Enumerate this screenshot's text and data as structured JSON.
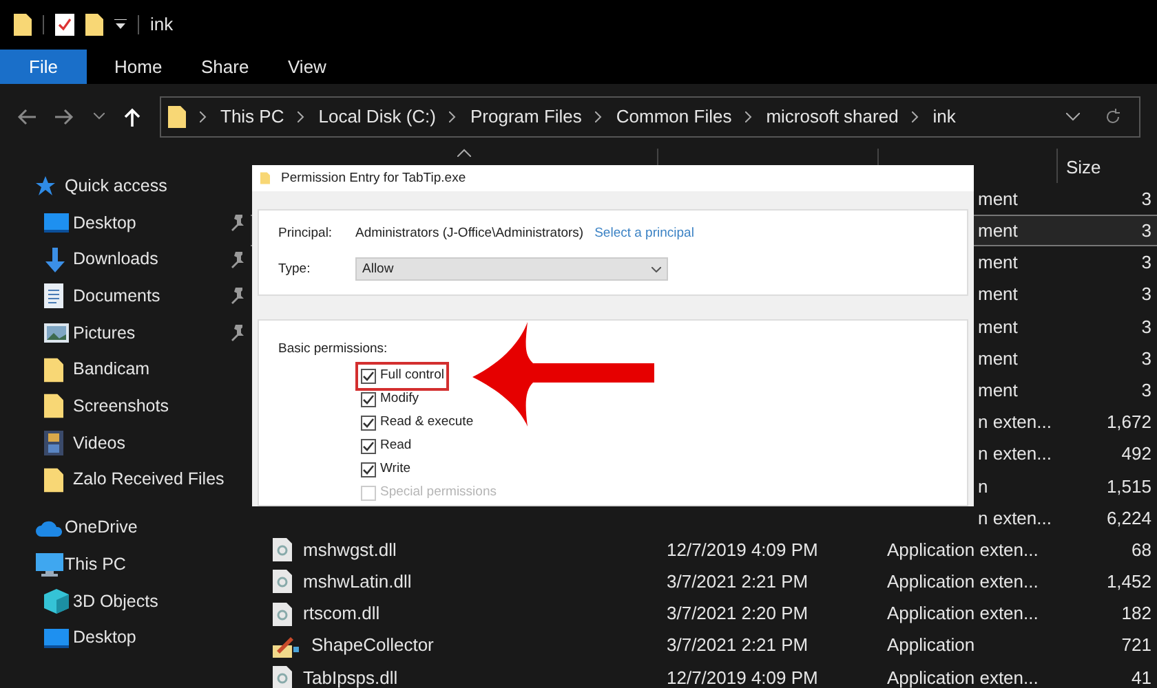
{
  "window": {
    "title": "ink"
  },
  "ribbon_tabs": [
    {
      "label": "File",
      "selected": true
    },
    {
      "label": "Home",
      "selected": false
    },
    {
      "label": "Share",
      "selected": false
    },
    {
      "label": "View",
      "selected": false
    }
  ],
  "breadcrumb": [
    "This PC",
    "Local Disk (C:)",
    "Program Files",
    "Common Files",
    "microsoft shared",
    "ink"
  ],
  "sidebar": {
    "items": [
      {
        "label": "Quick access",
        "kind": "star",
        "pinned": false,
        "children": [
          {
            "label": "Desktop",
            "kind": "desktop",
            "pinned": true
          },
          {
            "label": "Downloads",
            "kind": "download",
            "pinned": true
          },
          {
            "label": "Documents",
            "kind": "document",
            "pinned": true
          },
          {
            "label": "Pictures",
            "kind": "pictures",
            "pinned": true
          },
          {
            "label": "Bandicam",
            "kind": "folder",
            "pinned": false
          },
          {
            "label": "Screenshots",
            "kind": "folder",
            "pinned": false
          },
          {
            "label": "Videos",
            "kind": "videos",
            "pinned": false
          },
          {
            "label": "Zalo Received Files",
            "kind": "folder",
            "pinned": false
          }
        ]
      },
      {
        "label": "OneDrive",
        "kind": "cloud",
        "pinned": false
      },
      {
        "label": "This PC",
        "kind": "pc",
        "pinned": false,
        "children": [
          {
            "label": "3D Objects",
            "kind": "cube",
            "pinned": false
          },
          {
            "label": "Desktop",
            "kind": "desktop",
            "pinned": false
          }
        ]
      }
    ]
  },
  "file_list": {
    "size_header": "Size",
    "rows": [
      {
        "kind": "partial",
        "type": "ment",
        "size": "3",
        "selected": false
      },
      {
        "kind": "partial",
        "type": "ment",
        "size": "3",
        "selected": true
      },
      {
        "kind": "partial",
        "type": "ment",
        "size": "3",
        "selected": false
      },
      {
        "kind": "partial",
        "type": "ment",
        "size": "3",
        "selected": false
      },
      {
        "kind": "partial",
        "type": "ment",
        "size": "3",
        "selected": false
      },
      {
        "kind": "partial",
        "type": "ment",
        "size": "3",
        "selected": false
      },
      {
        "kind": "partial",
        "type": "ment",
        "size": "3",
        "selected": false
      },
      {
        "kind": "partial",
        "type": "n exten...",
        "size": "1,672",
        "selected": false
      },
      {
        "kind": "partial",
        "type": "n exten...",
        "size": "492",
        "selected": false
      },
      {
        "kind": "partial",
        "type": "n",
        "size": "1,515",
        "selected": false
      },
      {
        "kind": "partial",
        "type": "n exten...",
        "size": "6,224",
        "selected": false
      },
      {
        "kind": "dll",
        "name": "mshwgst.dll",
        "date": "12/7/2019 4:09 PM",
        "type": "Application exten...",
        "size": "68",
        "selected": false
      },
      {
        "kind": "dll",
        "name": "mshwLatin.dll",
        "date": "3/7/2021 2:21 PM",
        "type": "Application exten...",
        "size": "1,452",
        "selected": false
      },
      {
        "kind": "dll",
        "name": "rtscom.dll",
        "date": "3/7/2021 2:20 PM",
        "type": "Application exten...",
        "size": "182",
        "selected": false
      },
      {
        "kind": "app",
        "name": "ShapeCollector",
        "date": "3/7/2021 2:21 PM",
        "type": "Application",
        "size": "721",
        "selected": false
      },
      {
        "kind": "dll",
        "name": "TabIpsps.dll",
        "date": "12/7/2019 4:09 PM",
        "type": "Application exten...",
        "size": "41",
        "selected": false
      }
    ]
  },
  "dialog": {
    "title": "Permission Entry for TabTip.exe",
    "principal_label": "Principal:",
    "principal": "Administrators (J-Office\\Administrators)",
    "principal_link": "Select a principal",
    "type_label": "Type:",
    "type_value": "Allow",
    "permissions_label": "Basic permissions:",
    "permissions": [
      {
        "label": "Full control",
        "checked": true,
        "disabled": false,
        "annotated": true
      },
      {
        "label": "Modify",
        "checked": true,
        "disabled": false,
        "annotated": false
      },
      {
        "label": "Read & execute",
        "checked": true,
        "disabled": false,
        "annotated": false
      },
      {
        "label": "Read",
        "checked": true,
        "disabled": false,
        "annotated": false
      },
      {
        "label": "Write",
        "checked": true,
        "disabled": false,
        "annotated": false
      },
      {
        "label": "Special permissions",
        "checked": false,
        "disabled": true,
        "annotated": false
      }
    ]
  }
}
